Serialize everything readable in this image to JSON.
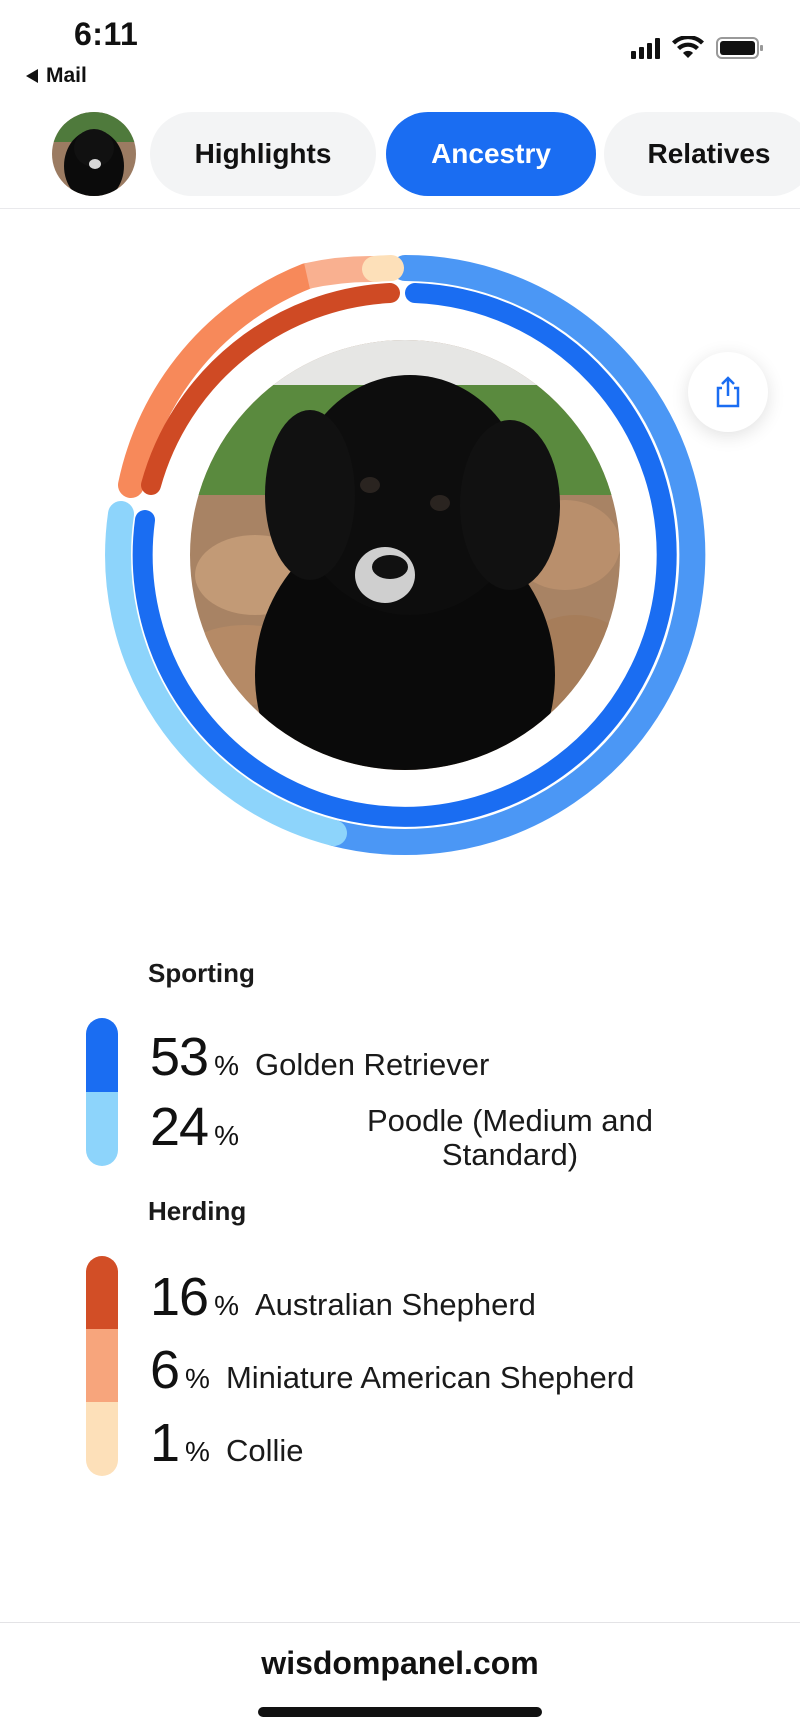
{
  "status_bar": {
    "time": "6:11",
    "back_label": "Mail"
  },
  "tabs": [
    {
      "label": "Highlights",
      "active": false
    },
    {
      "label": "Ancestry",
      "active": true
    },
    {
      "label": "Relatives",
      "active": false
    }
  ],
  "breakdown": {
    "groups": [
      {
        "name": "Sporting",
        "breeds": [
          {
            "percent": "53",
            "sign": "%",
            "name": "Golden Retriever",
            "color": "#1a6df2"
          },
          {
            "percent": "24",
            "sign": "%",
            "name": "Poodle (Medium and Standard)",
            "color": "#8dd4fb"
          }
        ]
      },
      {
        "name": "Herding",
        "breeds": [
          {
            "percent": "16",
            "sign": "%",
            "name": "Australian Shepherd",
            "color": "#d24e26"
          },
          {
            "percent": "6",
            "sign": "%",
            "name": "Miniature American Shepherd",
            "color": "#f7a57c"
          },
          {
            "percent": "1",
            "sign": "%",
            "name": "Collie",
            "color": "#fde0b9"
          }
        ]
      }
    ]
  },
  "footer": {
    "url": "wisdompanel.com"
  },
  "icons": {
    "share": "share-icon",
    "back": "back-triangle-icon",
    "signal": "signal-icon",
    "wifi": "wifi-icon",
    "battery": "battery-icon"
  }
}
